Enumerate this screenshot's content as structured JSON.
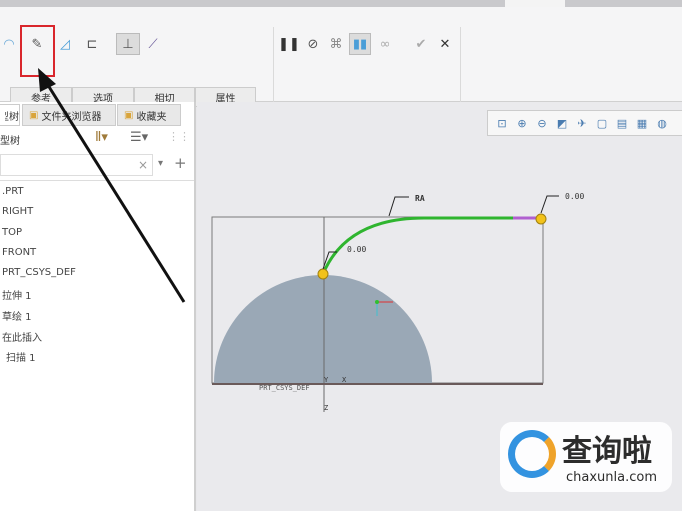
{
  "ribbon": {
    "subtabs": [
      "参考",
      "选项",
      "相切",
      "属性"
    ],
    "icons": [
      "surface-icon",
      "sketch-icon",
      "plane-icon",
      "bracket-icon",
      "normal-icon",
      "tangent-icon",
      "pause-icon",
      "stop-icon",
      "preview-icon",
      "verify-icon",
      "glasses-icon",
      "ok-icon",
      "cancel-icon"
    ]
  },
  "panel": {
    "tabs": [
      "模型树",
      "文件夹浏览器",
      "收藏夹"
    ],
    "header": "模型树",
    "search_clear": "×",
    "tree": [
      ".PRT",
      "RIGHT",
      "TOP",
      "FRONT",
      "PRT_CSYS_DEF",
      "拉伸 1",
      "草绘 1",
      "在此插入",
      "扫描 1"
    ]
  },
  "viewport": {
    "labels": {
      "ra": "RA",
      "start_value": "0.00",
      "end_value": "0.00",
      "csys": "PRT_CSYS_DEF",
      "y": "Y",
      "x": "X",
      "z": "Z"
    }
  },
  "watermark": {
    "title": "查询啦",
    "url": "chaxunla.com"
  },
  "colors": {
    "highlight": "#d9262c",
    "trajectory": "#2fb52f",
    "solid": "#9aa8b6"
  }
}
